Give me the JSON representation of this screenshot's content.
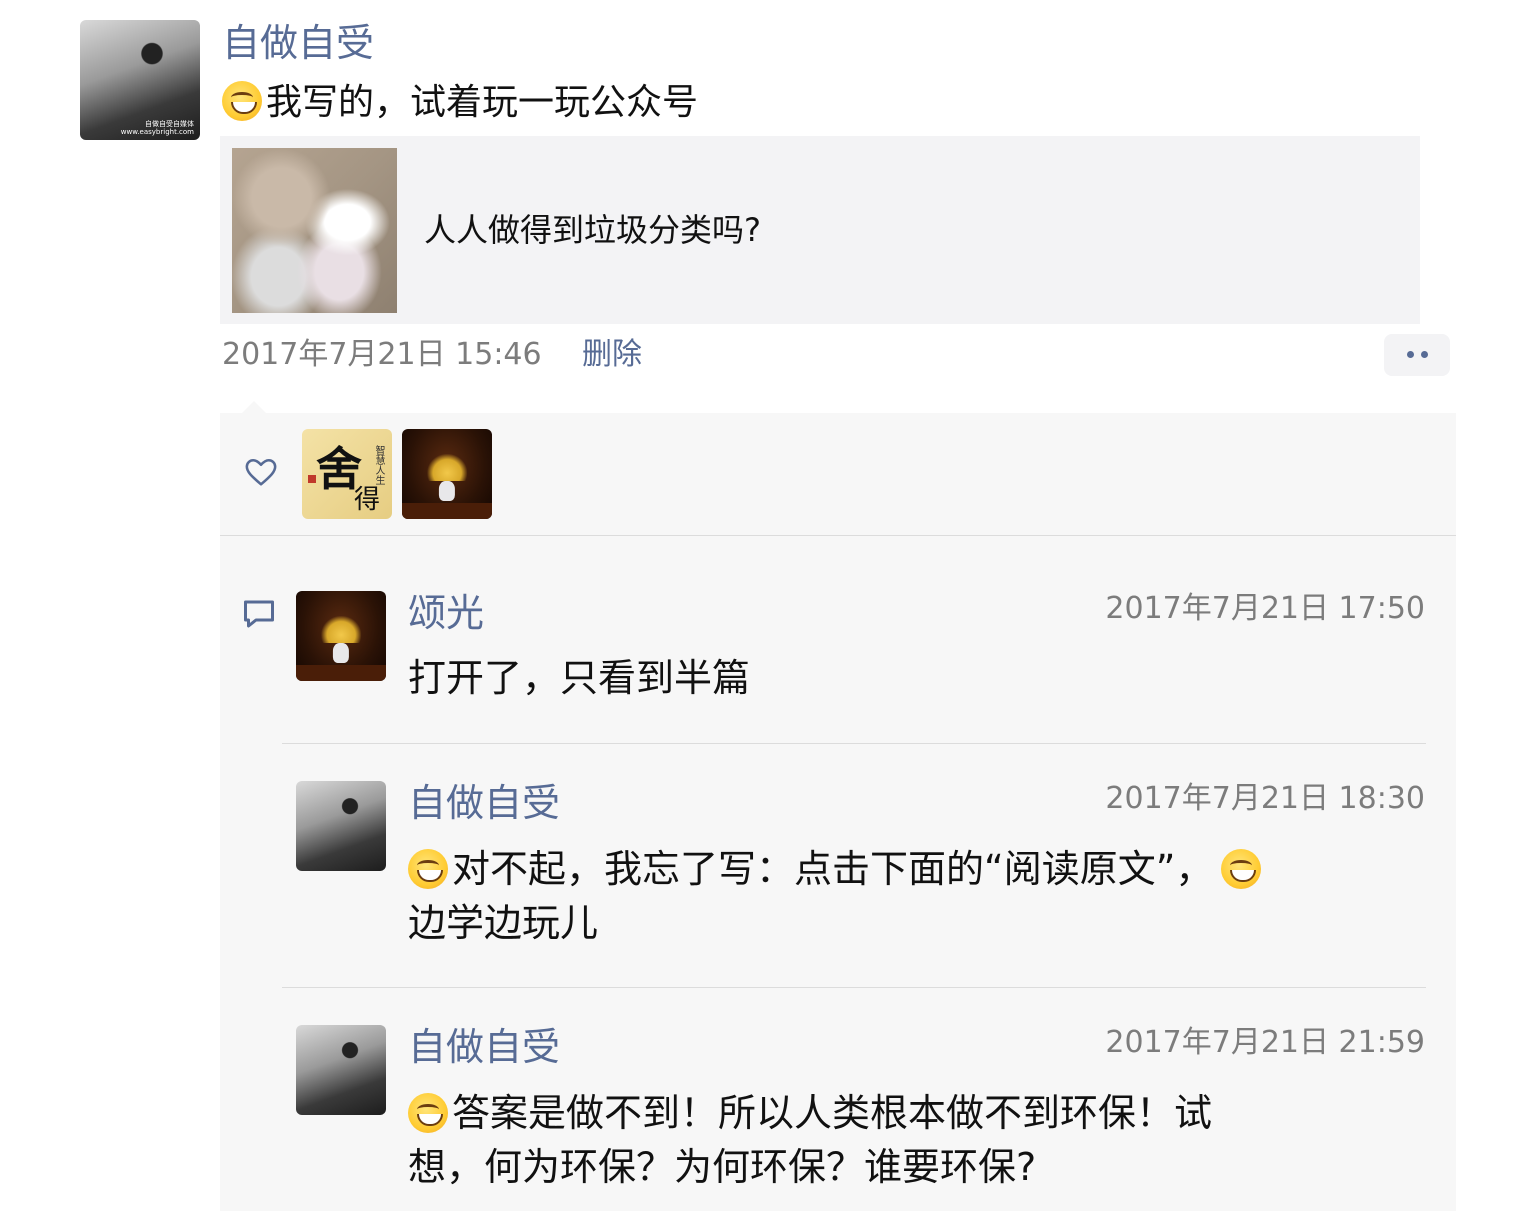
{
  "post": {
    "author": "自做自受",
    "avatar_caption": "自做自受自媒体\nwww.easybright.com",
    "content": "我写的，试着玩一玩公众号",
    "link_card": {
      "title": "人人做得到垃圾分类吗?"
    },
    "timestamp": "2017年7月21日 15:46",
    "delete_label": "删除"
  },
  "likes": {
    "icon": "heart-outline-icon",
    "users": [
      {
        "avatar": "calligraphy-avatar",
        "big_char": "舍",
        "small_char": "得",
        "side_text": "智慧人生"
      },
      {
        "avatar": "vase-flower-avatar"
      }
    ]
  },
  "comments": [
    {
      "author": "颂光",
      "avatar": "vase-flower-avatar",
      "time": "2017年7月21日 17:50",
      "text": "打开了，只看到半篇"
    },
    {
      "author": "自做自受",
      "avatar": "photo-avatar",
      "time": "2017年7月21日 18:30",
      "text_line1": "对不起，我忘了写：点击下面的“阅读原文”，",
      "text_line2": "边学边玩儿"
    },
    {
      "author": "自做自受",
      "avatar": "photo-avatar",
      "time": "2017年7月21日 21:59",
      "text_line1": "答案是做不到！所以人类根本做不到环保！试",
      "text_line2": "想，何为环保？为何环保？谁要环保?"
    }
  ],
  "colors": {
    "name": "#576b95",
    "time": "#7c7c7c",
    "bg_comment": "#f7f7f7"
  }
}
